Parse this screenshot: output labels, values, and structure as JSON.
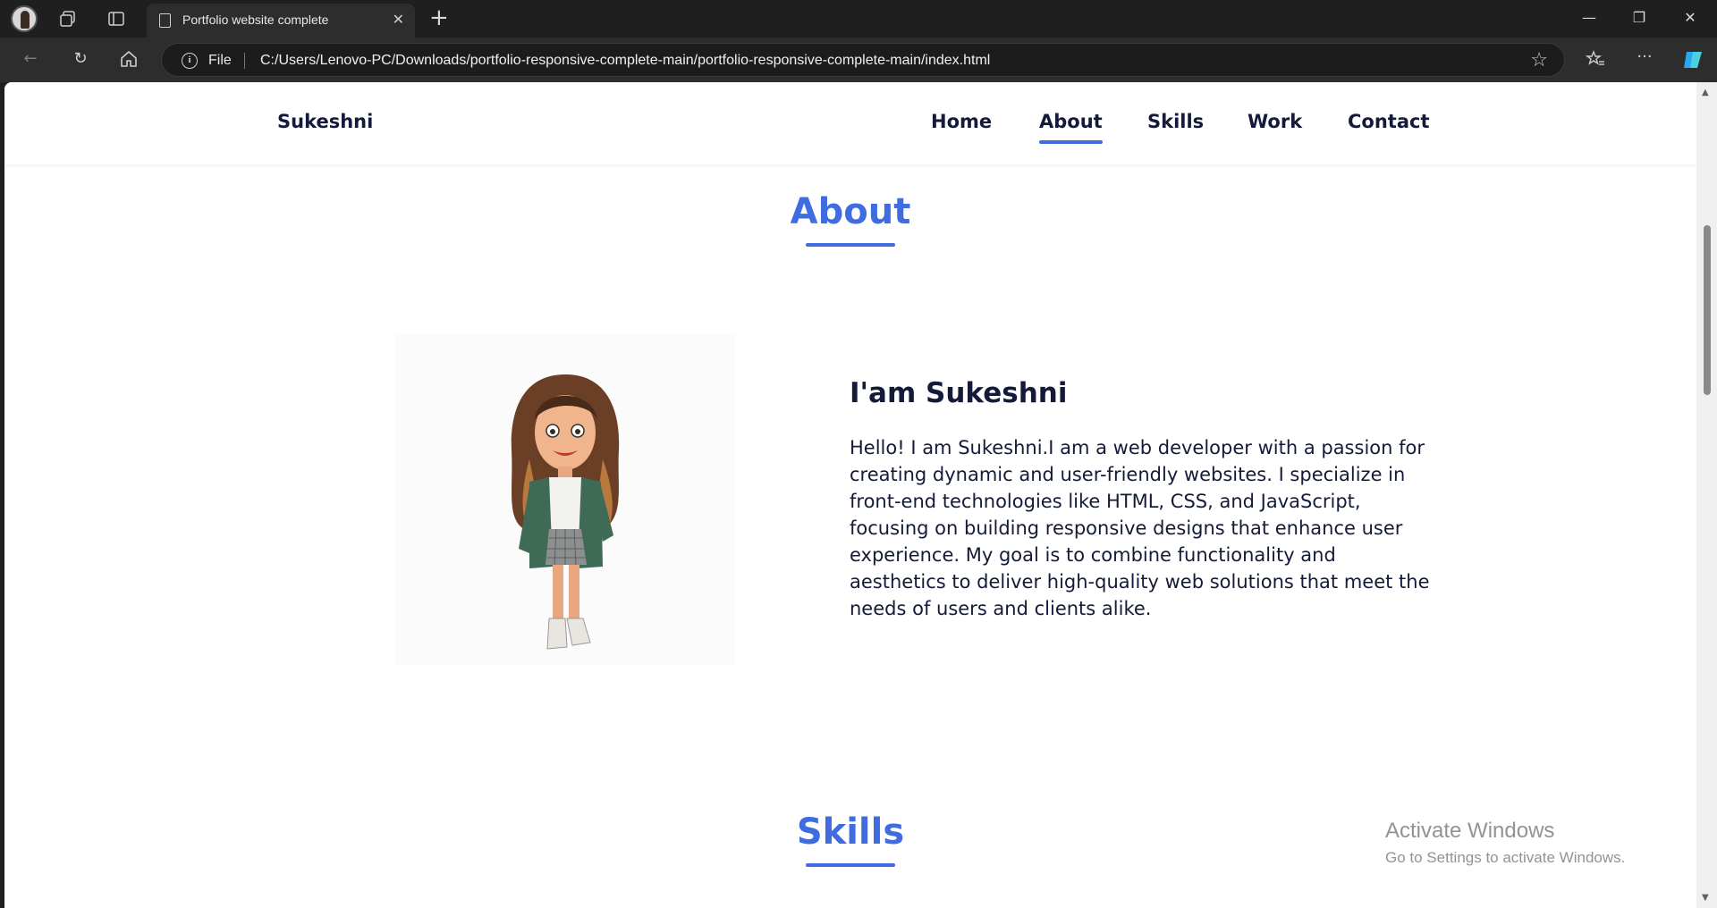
{
  "browser": {
    "tab_title": "Portfolio website complete",
    "new_tab_label": "+",
    "address_scheme_label": "File",
    "address_url": "C:/Users/Lenovo-PC/Downloads/portfolio-responsive-complete-main/portfolio-responsive-complete-main/index.html",
    "icons": [
      "profile-avatar",
      "workspaces-icon",
      "tab-actions-icon",
      "page-icon",
      "close-icon",
      "minimize-icon",
      "restore-icon",
      "window-close-icon",
      "back-icon",
      "refresh-icon",
      "home-icon",
      "info-icon",
      "favorite-star-icon",
      "favorites-icon",
      "more-icon",
      "copilot-icon"
    ]
  },
  "site": {
    "logo": "Sukeshni",
    "nav": [
      {
        "label": "Home",
        "active": false
      },
      {
        "label": "About",
        "active": true
      },
      {
        "label": "Skills",
        "active": false
      },
      {
        "label": "Work",
        "active": false
      },
      {
        "label": "Contact",
        "active": false
      }
    ],
    "accent_color": "#3f6de0",
    "text_color": "#141b3a"
  },
  "about": {
    "section_title": "About",
    "subtitle": "I'am Sukeshni",
    "text": "Hello! I am Sukeshni.I am a web developer with a passion for creating dynamic and user-friendly websites. I specialize in front-end technologies like HTML, CSS, and JavaScript, focusing on building responsive designs that enhance user experience. My goal is to combine functionality and aesthetics to deliver high-quality web solutions that meet the needs of users and clients alike."
  },
  "skills": {
    "section_title": "Skills"
  },
  "watermark": {
    "line1": "Activate Windows",
    "line2": "Go to Settings to activate Windows."
  }
}
